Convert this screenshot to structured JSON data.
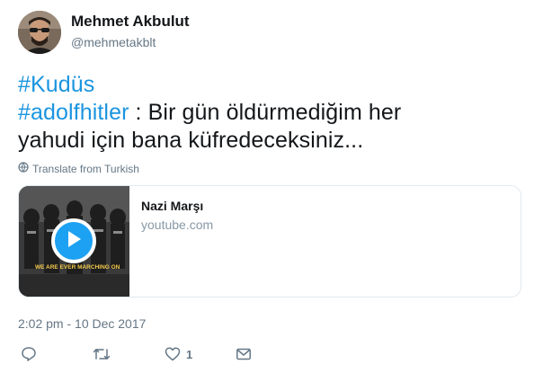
{
  "user": {
    "name": "Mehmet Akbulut",
    "handle": "@mehmetakblt"
  },
  "tweet": {
    "hashtag1": "#Kudüs",
    "hashtag2": "#adolfhitler",
    "text_part1": " : Bir gün öldürmediğim her",
    "text_part2": "yahudi için bana küfredeceksiniz...",
    "translate_label": "Translate from Turkish",
    "timestamp": "2:02 pm - 10 Dec 2017"
  },
  "card": {
    "title": "Nazi Marşı",
    "domain": "youtube.com",
    "thumbnail_caption": "WE ARE EVER MARCHING ON"
  },
  "actions": {
    "like_count": "1"
  },
  "colors": {
    "link": "#1b95e0",
    "accent": "#1da1f2",
    "muted": "#657786"
  },
  "icons": {
    "reply": "reply-icon",
    "retweet": "retweet-icon",
    "like": "heart-icon",
    "dm": "envelope-icon",
    "translate": "globe-icon",
    "play": "play-icon"
  }
}
